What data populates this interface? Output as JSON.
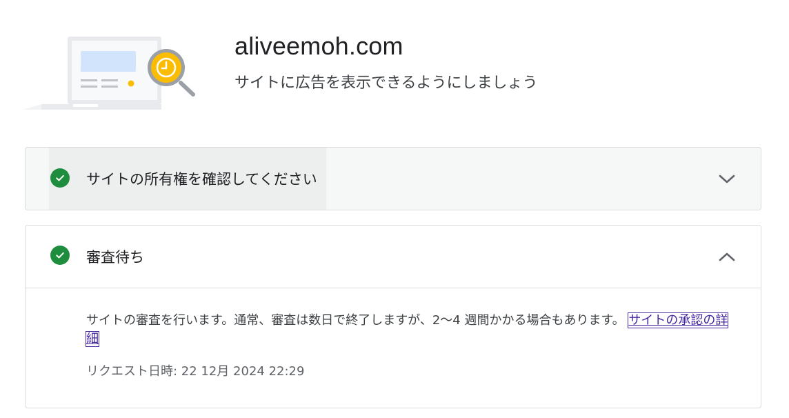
{
  "site": {
    "name": "aliveemoh.com",
    "subtitle": "サイトに広告を表示できるようにしましょう"
  },
  "steps": [
    {
      "title": "サイトの所有権を確認してください",
      "status": "complete",
      "expanded": false
    },
    {
      "title": "審査待ち",
      "status": "complete",
      "expanded": true,
      "description": "サイトの審査を行います。通常、審査は数日で終了しますが、2～4 週間かかる場合もあります。",
      "link_text": "サイトの承認の詳細",
      "request_time": "リクエスト日時: 22 12月 2024 22:29"
    }
  ],
  "icons": {
    "step_status": "check-circle-icon",
    "collapsed": "chevron-down-icon",
    "expanded": "chevron-up-icon"
  },
  "colors": {
    "success": "#1e8e3e",
    "link": "#4527a0",
    "illustration_accent": "#fbbc04"
  }
}
